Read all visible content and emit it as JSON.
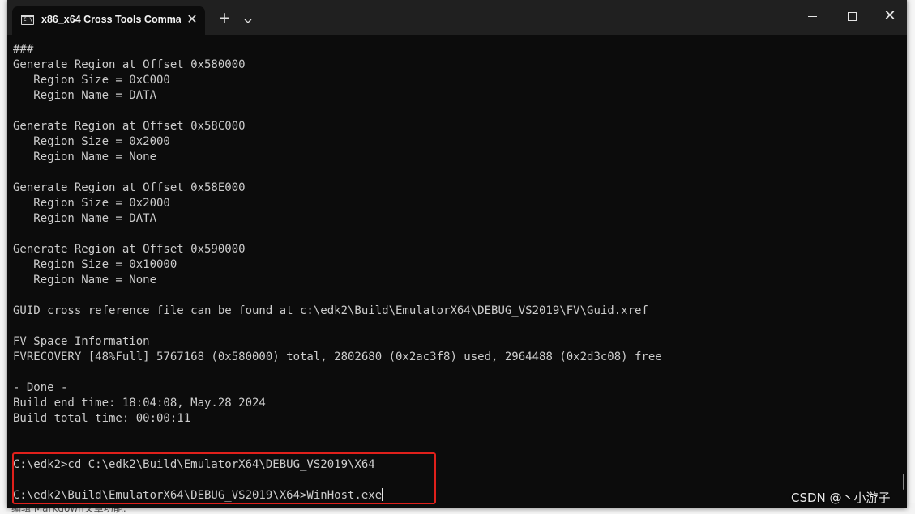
{
  "window": {
    "tab_title": "x86_x64 Cross Tools Comman",
    "tab_icon_text": "C:\\",
    "tab_close": "✕",
    "new_tab": "+",
    "minimize": "minimize-icon",
    "maximize": "maximize-icon",
    "close": "✕"
  },
  "console": {
    "lines": [
      "###",
      "Generate Region at Offset 0x580000",
      "   Region Size = 0xC000",
      "   Region Name = DATA",
      "",
      "Generate Region at Offset 0x58C000",
      "   Region Size = 0x2000",
      "   Region Name = None",
      "",
      "Generate Region at Offset 0x58E000",
      "   Region Size = 0x2000",
      "   Region Name = DATA",
      "",
      "Generate Region at Offset 0x590000",
      "   Region Size = 0x10000",
      "   Region Name = None",
      "",
      "GUID cross reference file can be found at c:\\edk2\\Build\\EmulatorX64\\DEBUG_VS2019\\FV\\Guid.xref",
      "",
      "FV Space Information",
      "FVRECOVERY [48%Full] 5767168 (0x580000) total, 2802680 (0x2ac3f8) used, 2964488 (0x2d3c08) free",
      "",
      "- Done -",
      "Build end time: 18:04:08, May.28 2024",
      "Build total time: 00:00:11",
      "",
      "",
      "C:\\edk2>cd C:\\edk2\\Build\\EmulatorX64\\DEBUG_VS2019\\X64",
      "",
      "C:\\edk2\\Build\\EmulatorX64\\DEBUG_VS2019\\X64>WinHost.exe"
    ]
  },
  "watermark": "CSDN @丶小游子",
  "background_text": "编辑 Markdown文章功能:"
}
